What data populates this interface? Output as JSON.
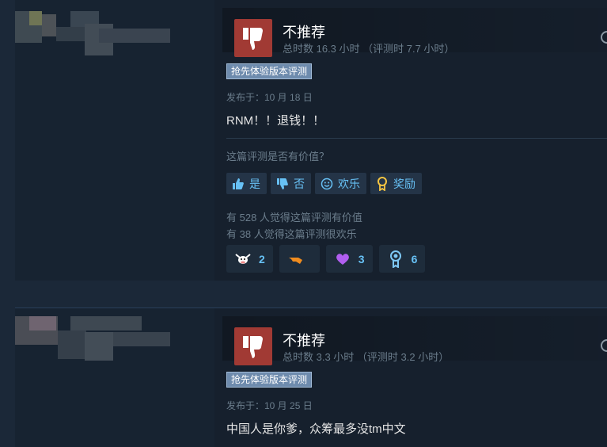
{
  "reviews": [
    {
      "verdict": "不推荐",
      "hours": "总时数 16.3 小时 （评测时 7.7 小时）",
      "badge": "抢先体验版本评测",
      "posted": "发布于：10 月 18 日",
      "text": "RNM！！退钱！！",
      "helpful_question": "这篇评测是否有价值？",
      "buttons": {
        "yes": "是",
        "no": "否",
        "funny": "欢乐",
        "award": "奖励"
      },
      "votes_helpful": "有 528 人觉得这篇评测有价值",
      "votes_funny": "有 38 人觉得这篇评测很欢乐",
      "awards": [
        {
          "icon": "cow-award-icon",
          "count": "2"
        },
        {
          "icon": "hand-award-icon",
          "count": ""
        },
        {
          "icon": "heart-award-icon",
          "count": "3"
        },
        {
          "icon": "medal-award-icon",
          "count": "6"
        }
      ]
    },
    {
      "verdict": "不推荐",
      "hours": "总时数 3.3 小时 （评测时 3.2 小时）",
      "badge": "抢先体验版本评测",
      "posted": "发布于：10 月 25 日",
      "text": "中国人是你爹，众筹最多没tm中文"
    }
  ],
  "colors": {
    "background": "#1b2838",
    "thumb_down_bg": "#a13a34",
    "link_blue": "#67c1f5",
    "badge_bg": "#6e8bad"
  }
}
